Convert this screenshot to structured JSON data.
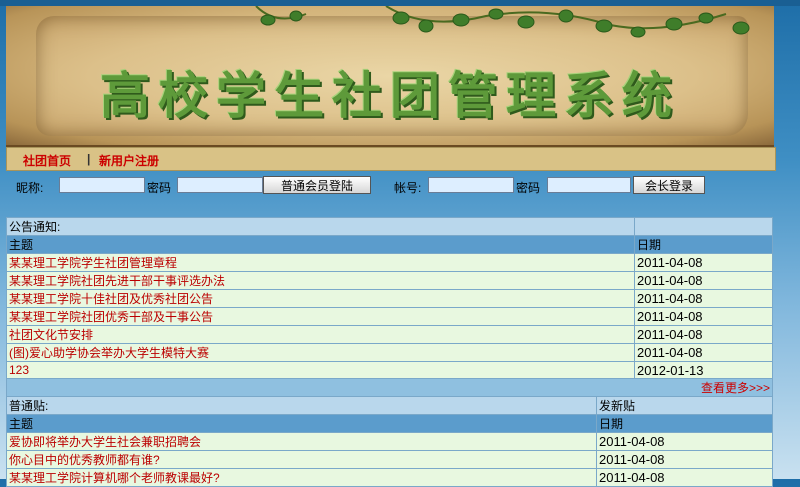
{
  "banner": {
    "title": "高校学生社团管理系统"
  },
  "nav": {
    "home": "社团首页",
    "separator": "|",
    "register": "新用户注册"
  },
  "login": {
    "nickname_label": "昵称:",
    "password_label1": "密码",
    "member_login": "普通会员登陆",
    "account_label": "帐号:",
    "password_label2": "密码",
    "president_login": "会长登录"
  },
  "announcements": {
    "section_title": "公告通知:",
    "col_title": "主题",
    "col_date": "日期",
    "items": [
      {
        "title": "某某理工学院学生社团管理章程",
        "date": "2011-04-08"
      },
      {
        "title": "某某理工学院社团先进干部干事评选办法",
        "date": "2011-04-08"
      },
      {
        "title": "某某理工学院十佳社团及优秀社团公告",
        "date": "2011-04-08"
      },
      {
        "title": "某某理工学院社团优秀干部及干事公告",
        "date": "2011-04-08"
      },
      {
        "title": "社团文化节安排",
        "date": "2011-04-08"
      },
      {
        "title": "(图)爱心助学协会举办大学生模特大赛",
        "date": "2011-04-08"
      },
      {
        "title": "123",
        "date": "2012-01-13"
      }
    ],
    "more": "查看更多>>>"
  },
  "posts": {
    "section_title": "普通贴:",
    "new_post": "发新贴",
    "col_title": "主题",
    "col_date": "日期",
    "items": [
      {
        "title": "爱协即将举办大学生社会兼职招聘会",
        "date": "2011-04-08"
      },
      {
        "title": "你心目中的优秀教师都有谁?",
        "date": "2011-04-08"
      },
      {
        "title": "某某理工学院计算机哪个老师教课最好?",
        "date": "2011-04-08"
      }
    ]
  }
}
